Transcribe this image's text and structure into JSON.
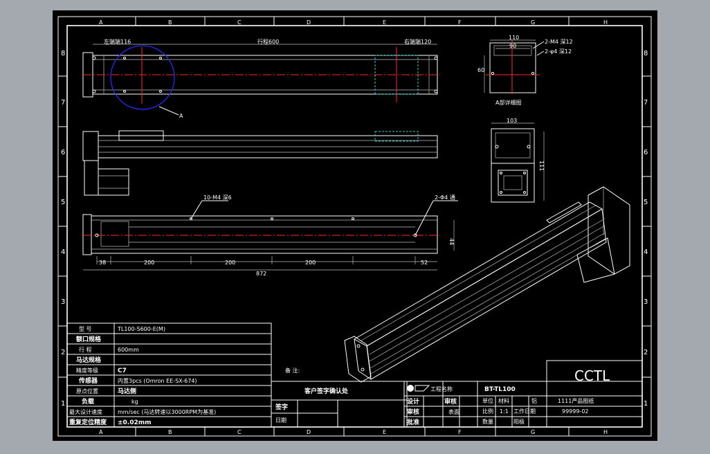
{
  "columns": [
    "A",
    "B",
    "C",
    "D",
    "E",
    "F",
    "G",
    "H"
  ],
  "rows": [
    "8",
    "7",
    "6",
    "5",
    "4",
    "3",
    "2",
    "1"
  ],
  "dims": {
    "left_end": "左端端116",
    "stroke": "行程600",
    "right_end": "右端端120",
    "hole_spec_top": "2-M4 深12",
    "hole_spec_top2": "2-φ4 深12",
    "w110": "110",
    "w90": "90",
    "h60": "60",
    "w103": "103",
    "h111": "111",
    "slot": "10-M4 深6",
    "holes": "2-Φ4 通",
    "h44": "44",
    "b38": "38",
    "s200a": "200",
    "s200b": "200",
    "s200c": "200",
    "b52": "52",
    "total": "872",
    "detail_tag": "A",
    "detail_label": "A部详细图"
  },
  "spec_table": [
    {
      "label": "型 号",
      "value": "TL100-S600-E(M)"
    },
    {
      "label": "额口规格",
      "value": ""
    },
    {
      "label": "行 程",
      "value": "600mm"
    },
    {
      "label": "马达规格",
      "value": ""
    },
    {
      "label": "精度等级",
      "value": "C7"
    },
    {
      "label": "传感器",
      "value": "内置3pcs (Omron EE-SX-674)"
    },
    {
      "label": "原点位置",
      "value": "马达侧"
    },
    {
      "label": "负载",
      "value": "kg"
    },
    {
      "label": "最大设计速度",
      "value": "mm/sec  (马达转速以3000RPM为基准)"
    },
    {
      "label": "重复定位精度",
      "value": "±0.02mm"
    }
  ],
  "notes": {
    "remark_label": "备 注:",
    "customer_confirm": "客户签字确认处",
    "sign": "签字",
    "date": "日期"
  },
  "title_block": {
    "company": "CCTL",
    "project_label": "工程名称",
    "drawing_no": "BT-TL100",
    "product_name": "1111产品图纸",
    "code": "99999-02",
    "design": "设计",
    "check": "审核",
    "approve": "批准",
    "material": "材料",
    "material_val": "铝",
    "scale": "比例",
    "scale_val": "1:1",
    "surface": "表面",
    "surface_val": "阳极",
    "qty": "数量",
    "date_label": "工作日期",
    "unit_label": "单位"
  }
}
